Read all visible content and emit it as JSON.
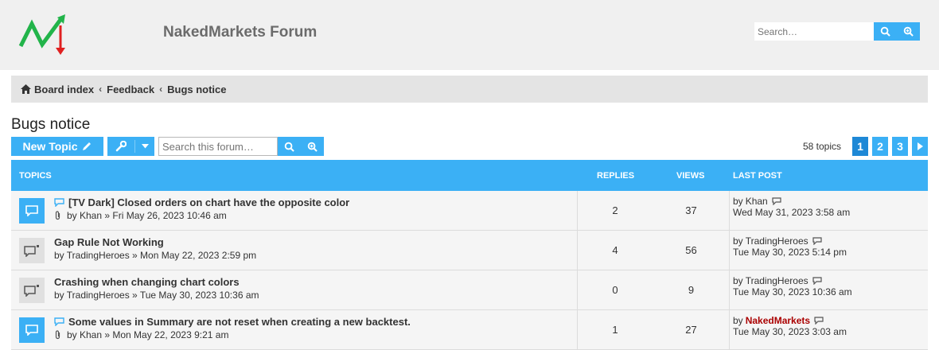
{
  "header": {
    "site_title": "NakedMarkets Forum",
    "search_placeholder": "Search…"
  },
  "breadcrumbs": [
    "Board index",
    "Feedback",
    "Bugs notice"
  ],
  "page_title": "Bugs notice",
  "actions": {
    "new_topic_label": "New Topic",
    "forum_search_placeholder": "Search this forum…"
  },
  "pagination": {
    "count_label": "58 topics",
    "pages": [
      "1",
      "2",
      "3"
    ],
    "current": "1"
  },
  "table": {
    "headers": {
      "topics": "TOPICS",
      "replies": "REPLIES",
      "views": "VIEWS",
      "last_post": "LAST POST"
    },
    "rows": [
      {
        "title": "[TV Dark] Closed orders on chart have the opposite color",
        "meta": "by Khan » Fri May 26, 2023 10:46 am",
        "replies": "2",
        "views": "37",
        "last_by": "by",
        "last_author": "Khan",
        "last_date": "Wed May 31, 2023 3:58 am",
        "unread": true,
        "attachment": true
      },
      {
        "title": "Gap Rule Not Working",
        "meta": "by TradingHeroes » Mon May 22, 2023 2:59 pm",
        "replies": "4",
        "views": "56",
        "last_by": "by",
        "last_author": "TradingHeroes",
        "last_date": "Tue May 30, 2023 5:14 pm",
        "unread": false,
        "attachment": false
      },
      {
        "title": "Crashing when changing chart colors",
        "meta": "by TradingHeroes » Tue May 30, 2023 10:36 am",
        "replies": "0",
        "views": "9",
        "last_by": "by",
        "last_author": "TradingHeroes",
        "last_date": "Tue May 30, 2023 10:36 am",
        "unread": false,
        "attachment": false
      },
      {
        "title": "Some values in Summary are not reset when creating a new backtest.",
        "meta": "by Khan » Mon May 22, 2023 9:21 am",
        "replies": "1",
        "views": "27",
        "last_by": "by",
        "last_author": "NakedMarkets",
        "last_date": "Tue May 30, 2023 3:03 am",
        "unread": true,
        "attachment": true
      }
    ]
  },
  "colors": {
    "accent": "#3bb0f5",
    "admin": "#aa0000"
  }
}
